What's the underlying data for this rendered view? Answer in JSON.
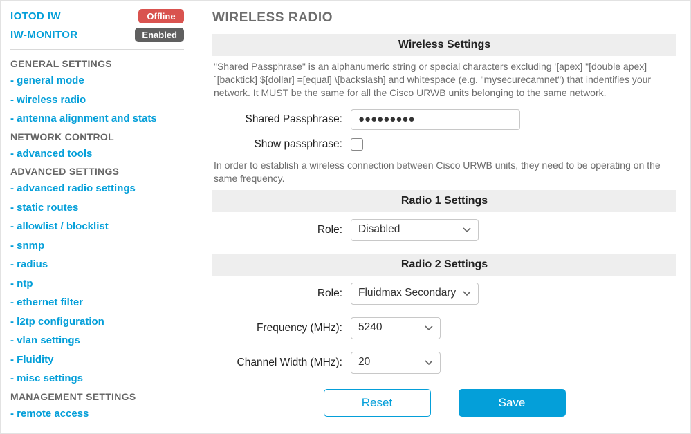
{
  "sidebar": {
    "status": {
      "iotod": {
        "label": "IOTOD IW",
        "badge": "Offline"
      },
      "monitor": {
        "label": "IW-MONITOR",
        "badge": "Enabled"
      }
    },
    "sections": {
      "general": {
        "heading": "GENERAL SETTINGS",
        "items": [
          "- general mode",
          "- wireless radio",
          "- antenna alignment and stats"
        ]
      },
      "network": {
        "heading": "NETWORK CONTROL",
        "items": [
          "- advanced tools"
        ]
      },
      "advanced": {
        "heading": "ADVANCED SETTINGS",
        "items": [
          "- advanced radio settings",
          "- static routes",
          "- allowlist / blocklist",
          "- snmp",
          "- radius",
          "- ntp",
          "- ethernet filter",
          "- l2tp configuration",
          "- vlan settings",
          "- Fluidity",
          "- misc settings"
        ]
      },
      "management": {
        "heading": "MANAGEMENT SETTINGS",
        "items": [
          "- remote access"
        ]
      }
    }
  },
  "main": {
    "title": "WIRELESS RADIO",
    "wireless": {
      "heading": "Wireless Settings",
      "help1": "\"Shared Passphrase\" is an alphanumeric string or special characters excluding '[apex] \"[double apex] `[backtick] $[dollar] =[equal] \\[backslash] and whitespace (e.g. \"mysecurecamnet\") that indentifies your network. It MUST be the same for all the Cisco URWB units belonging to the same network.",
      "passphrase_label": "Shared Passphrase:",
      "passphrase_value": "●●●●●●●●●",
      "show_label": "Show passphrase:",
      "help2": "In order to establish a wireless connection between Cisco URWB units, they need to be operating on the same frequency."
    },
    "radio1": {
      "heading": "Radio 1 Settings",
      "role_label": "Role:",
      "role_value": "Disabled"
    },
    "radio2": {
      "heading": "Radio 2 Settings",
      "role_label": "Role:",
      "role_value": "Fluidmax Secondary",
      "freq_label": "Frequency (MHz):",
      "freq_value": "5240",
      "cw_label": "Channel Width (MHz):",
      "cw_value": "20"
    },
    "buttons": {
      "reset": "Reset",
      "save": "Save"
    }
  }
}
